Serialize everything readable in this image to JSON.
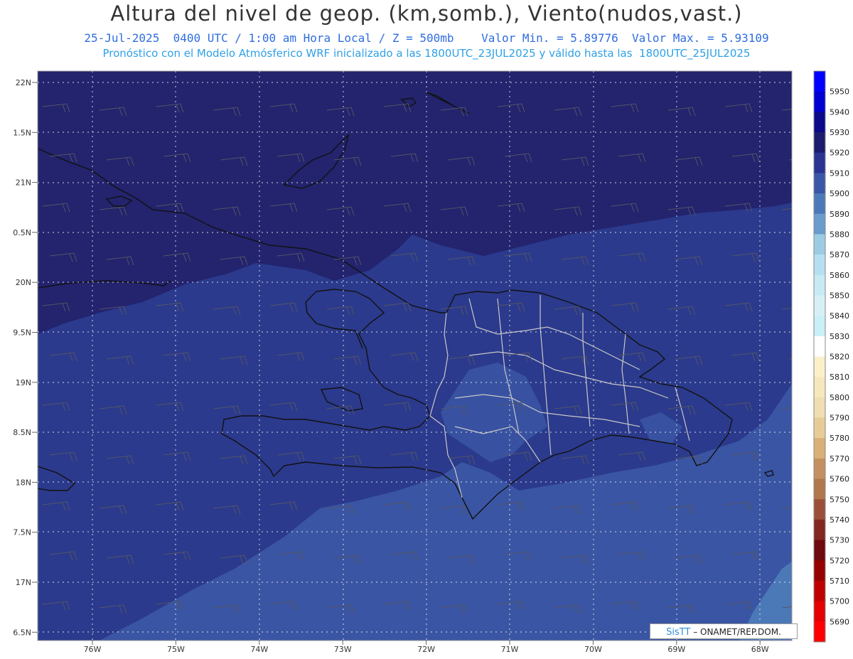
{
  "header": {
    "title": "Altura del nivel de geop. (km,somb.), Viento(nudos,vast.)",
    "subtitle": "25-Jul-2025  0400 UTC / 1:00 am Hora Local / Z = 500mb    Valor Min. = 5.89776  Valor Max. = 5.93109",
    "info": "Pronóstico con el Modelo Atmósferico WRF inicializado a las 1800UTC_23JUL2025 y válido hasta las  1800UTC_25JUL2025"
  },
  "map": {
    "lon_ticks": [
      "76W",
      "75W",
      "74W",
      "73W",
      "72W",
      "71W",
      "70W",
      "69W",
      "68W"
    ],
    "lat_ticks": [
      "22N",
      "1.5N",
      "21N",
      "0.5N",
      "20N",
      "9.5N",
      "19N",
      "8.5N",
      "18N",
      "7.5N",
      "17N",
      "6.5N"
    ],
    "colors": {
      "level_5920": "#23236e",
      "level_5910": "#2b3a8c",
      "level_5900": "#3a55a3",
      "level_5890": "#4b79b8",
      "coast": "#111111",
      "borders": "#c8c8c8"
    }
  },
  "colorbar": {
    "levels": [
      {
        "label": "5950",
        "color": "#0000ff"
      },
      {
        "label": "5940",
        "color": "#0000d2"
      },
      {
        "label": "5930",
        "color": "#0a0a8a"
      },
      {
        "label": "5920",
        "color": "#1c1c6e"
      },
      {
        "label": "5910",
        "color": "#2b3393"
      },
      {
        "label": "5900",
        "color": "#3a56a6"
      },
      {
        "label": "5890",
        "color": "#4c7ab8"
      },
      {
        "label": "5880",
        "color": "#6a9ccc"
      },
      {
        "label": "5870",
        "color": "#9ccce4"
      },
      {
        "label": "5860",
        "color": "#b6e0f0"
      },
      {
        "label": "5850",
        "color": "#c8eaf4"
      },
      {
        "label": "5840",
        "color": "#d6f0f6"
      },
      {
        "label": "5830",
        "color": "#c8f0f6"
      },
      {
        "label": "5820",
        "color": "#ffffff"
      },
      {
        "label": "5810",
        "color": "#fbf0c8"
      },
      {
        "label": "5800",
        "color": "#f6e8bc"
      },
      {
        "label": "5790",
        "color": "#f0deb0"
      },
      {
        "label": "5780",
        "color": "#e8cc98"
      },
      {
        "label": "5770",
        "color": "#d8b078"
      },
      {
        "label": "5760",
        "color": "#c49060"
      },
      {
        "label": "5750",
        "color": "#b0784c"
      },
      {
        "label": "5740",
        "color": "#9a5038"
      },
      {
        "label": "5730",
        "color": "#822820"
      },
      {
        "label": "5720",
        "color": "#6e0a10"
      },
      {
        "label": "5710",
        "color": "#960000"
      },
      {
        "label": "5700",
        "color": "#c00000"
      },
      {
        "label": "5690",
        "color": "#e40000"
      },
      {
        "label": "",
        "color": "#ff0000"
      }
    ]
  },
  "credit": {
    "brand": "SisTT",
    "text": " – ONAMET/REP.DOM."
  }
}
